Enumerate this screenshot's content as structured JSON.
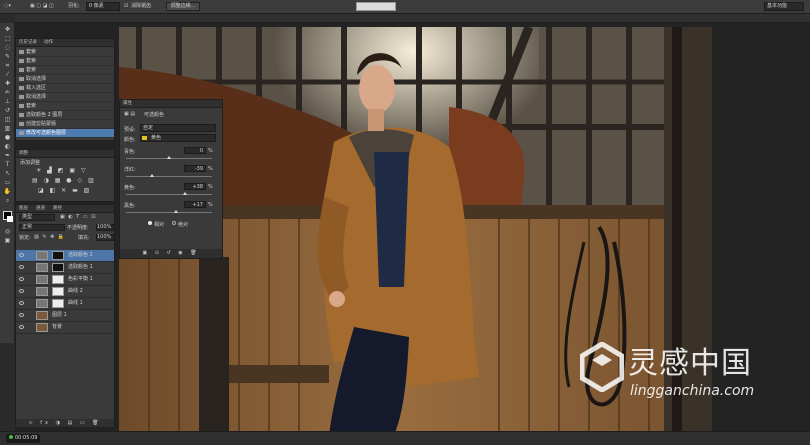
{
  "options_bar": {
    "feather_label": "羽化:",
    "feather_value": "0 像素",
    "antialias_label": "消除锯齿",
    "refine_label": "调整边缘...",
    "workspace": "基本功能"
  },
  "history_panel": {
    "tabs": [
      "历史记录",
      "动作"
    ],
    "items": [
      "套索",
      "套索",
      "套索",
      "取消选择",
      "载入选区",
      "取消选择",
      "套索",
      "选取颜色 2 图层",
      "创建剪贴蒙版",
      "修改可选颜色图层"
    ]
  },
  "adjust_panel": {
    "title": "调整",
    "subtitle": "添加调整"
  },
  "layers_panel": {
    "tabs": [
      "图层",
      "通道",
      "路径"
    ],
    "kind": "类型",
    "blend": "正常",
    "opacity_label": "不透明度:",
    "opacity": "100%",
    "lock_label": "锁定:",
    "fill_label": "填充:",
    "fill": "100%",
    "layers": [
      {
        "name": "选取颜色 2",
        "selected": true
      },
      {
        "name": "选取颜色 1",
        "selected": false
      },
      {
        "name": "色彩平衡 1",
        "selected": false
      },
      {
        "name": "曲线 2",
        "selected": false
      },
      {
        "name": "曲线 1",
        "selected": false
      },
      {
        "name": "图层 1",
        "selected": false
      },
      {
        "name": "背景",
        "selected": false
      }
    ]
  },
  "properties_panel": {
    "tab": "属性",
    "title": "可选颜色",
    "preset_label": "预设:",
    "preset_value": "自定",
    "colors_label": "颜色:",
    "colors_value": "黄色",
    "sliders": [
      {
        "label": "青色:",
        "value": "0",
        "unit": "%",
        "pos": 0.5
      },
      {
        "label": "洋红:",
        "value": "-39",
        "unit": "%",
        "pos": 0.305
      },
      {
        "label": "黄色:",
        "value": "+38",
        "unit": "%",
        "pos": 0.69
      },
      {
        "label": "黑色:",
        "value": "+17",
        "unit": "%",
        "pos": 0.585
      }
    ],
    "mode_relative": "相对",
    "mode_absolute": "绝对"
  },
  "status": {
    "time": "00:05:09"
  },
  "watermark": {
    "cn": "灵感中国",
    "en": "lingganchina.com"
  }
}
